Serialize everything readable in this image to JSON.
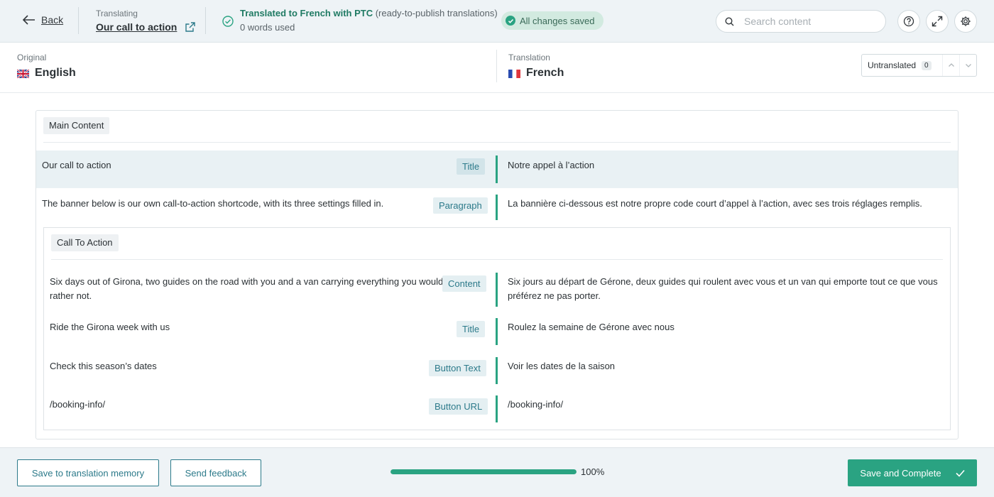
{
  "header": {
    "back_label": "Back",
    "translating_label": "Translating",
    "page_title": "Our call to action",
    "ptc_status": "Translated to French with PTC",
    "ptc_note": "(ready-to-publish translations)",
    "words_used": "0 words used",
    "saved_status": "All changes saved",
    "search_placeholder": "Search content",
    "icons": [
      "back-arrow-icon",
      "external-link-icon",
      "check-circle-icon",
      "search-icon",
      "help-icon",
      "expand-icon",
      "gear-icon"
    ]
  },
  "languages": {
    "original_label": "Original",
    "original_name": "English",
    "translation_label": "Translation",
    "translation_name": "French",
    "filter_label": "Untranslated",
    "filter_count": "0"
  },
  "content": {
    "main_section_label": "Main Content",
    "rows": [
      {
        "source": "Our call to action",
        "type": "Title",
        "target": "Notre appel à l’action"
      },
      {
        "source": "The banner below is our own call-to-action shortcode, with its three settings filled in.",
        "type": "Paragraph",
        "target": "La bannière ci-dessous est notre propre code court d’appel à l’action, avec ses trois réglages remplis."
      }
    ],
    "cta_section_label": "Call To Action",
    "cta_rows": [
      {
        "source": "Six days out of Girona, two guides on the road with you and a van carrying everything you would rather not.",
        "type": "Content",
        "target": "Six jours au départ de Gérone, deux guides qui roulent avec vous et un van qui emporte tout ce que vous préférez ne pas porter."
      },
      {
        "source": "Ride the Girona week with us",
        "type": "Title",
        "target": "Roulez la semaine de Gérone avec nous"
      },
      {
        "source": "Check this season’s dates",
        "type": "Button Text",
        "target": "Voir les dates de la saison"
      },
      {
        "source": "/booking-info/",
        "type": "Button URL",
        "target": "/booking-info/"
      }
    ]
  },
  "footer": {
    "save_memory_label": "Save to translation memory",
    "feedback_label": "Send feedback",
    "progress_percent": 100,
    "progress_label": "100%",
    "complete_label": "Save and Complete"
  },
  "colors": {
    "accent": "#2aa382",
    "link": "#2c7a8a",
    "header_bg": "#eef3f6",
    "highlight_row": "#e9f1f4"
  }
}
